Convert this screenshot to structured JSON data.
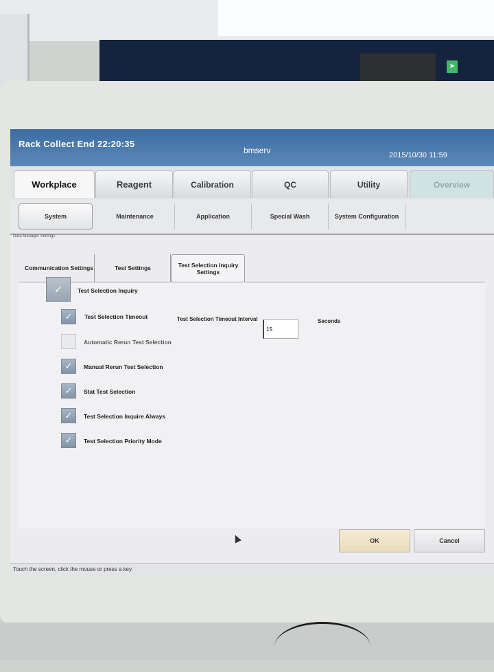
{
  "titlebar": {
    "status": "Rack Collect End 22:20:35",
    "host": "bmserv",
    "datetime": "2015/10/30   11:59"
  },
  "main_tabs": [
    {
      "label": "Workplace"
    },
    {
      "label": "Reagent"
    },
    {
      "label": "Calibration"
    },
    {
      "label": "QC"
    },
    {
      "label": "Utility"
    },
    {
      "label": "Overview"
    }
  ],
  "sub_tabs": [
    {
      "label": "System"
    },
    {
      "label": "Maintenance"
    },
    {
      "label": "Application"
    },
    {
      "label": "Special Wash"
    },
    {
      "label": "System Configuration"
    }
  ],
  "breadcrumb": "Data Manager Settings",
  "inner_tabs": [
    {
      "label": "Communication Settings"
    },
    {
      "label": "Test Settings"
    },
    {
      "label": "Test Selection Inquiry Settings"
    }
  ],
  "settings": {
    "master": {
      "label": "Test Selection Inquiry",
      "checked": true
    },
    "timeout": {
      "label": "Test Selection Timeout",
      "checked": true
    },
    "timeout_interval_label": "Test Selection Timeout Interval",
    "timeout_interval_value": "15",
    "timeout_unit": "Seconds",
    "automatic_rerun": {
      "label": "Automatic Rerun Test Selection",
      "checked": false
    },
    "manual_rerun": {
      "label": "Manual Rerun Test Selection",
      "checked": true
    },
    "stat": {
      "label": "Stat Test Selection",
      "checked": true
    },
    "inquire_always": {
      "label": "Test Selection Inquire Always",
      "checked": true
    },
    "priority_mode": {
      "label": "Test Selection Priority Mode",
      "checked": true
    }
  },
  "buttons": {
    "ok": "OK",
    "cancel": "Cancel"
  },
  "statusbar": "Touch the screen, click the mouse or press a key.",
  "icons": {
    "check": "check-icon",
    "cursor": "mouse-pointer-icon",
    "exit": "exit-sign-icon"
  },
  "colors": {
    "titlebar": "#3b6da3",
    "overview_tab": "#cfe3e2",
    "ok_button": "#f6ecd4"
  }
}
